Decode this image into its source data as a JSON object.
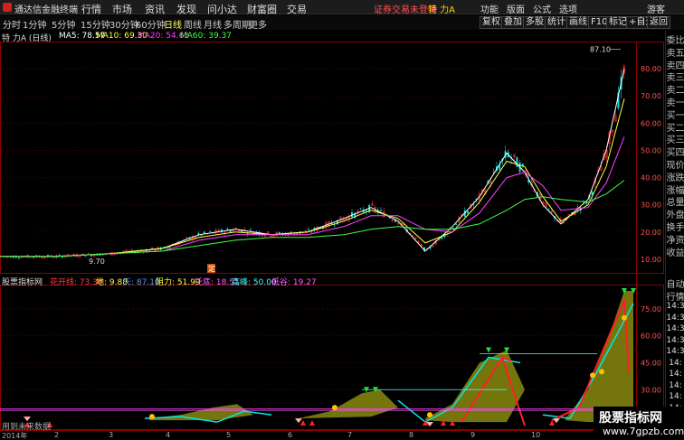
{
  "titlebar": {
    "app_name": "通达信金融终端",
    "menus": [
      "行情",
      "市场",
      "资讯",
      "发现",
      "问小达",
      "财富圈",
      "交易"
    ],
    "login_status": "证券交易未登录",
    "stock_name": "特 力A",
    "right_items": [
      "功能",
      "版面",
      "公式",
      "选项",
      "游客"
    ]
  },
  "toolbar": {
    "periods": [
      "分时",
      "1分钟",
      "5分钟",
      "15分钟",
      "30分钟",
      "60分钟",
      "日线",
      "周线",
      "月线",
      "多周期",
      "更多"
    ],
    "active_period": "日线",
    "buttons": [
      "复权",
      "叠加",
      "多股",
      "统计",
      "画线",
      "F10",
      "标记",
      "+自选",
      "返回"
    ]
  },
  "ma_legend": {
    "title": "特 力A (日线)",
    "ma5": "MA5: 78.57",
    "ma10": "MA10: 69.30",
    "ma20": "MA20: 54.63",
    "ma60": "MA60: 39.37"
  },
  "price_axis": {
    "labels": [
      "80.00",
      "70.00",
      "60.00",
      "50.00",
      "40.00",
      "30.00",
      "20.00",
      "10.00"
    ],
    "high_label": "87.10",
    "low_label": "9.70",
    "marker": "定"
  },
  "indicator_legend": {
    "name": "股票指标网",
    "items": [
      {
        "text": "花开线: 73.30",
        "color": "#ff4040"
      },
      {
        "text": "地: 9.88",
        "color": "#ffff40"
      },
      {
        "text": "天: 87.10",
        "color": "#40a0ff"
      },
      {
        "text": "阻力: 51.99",
        "color": "#ffff40"
      },
      {
        "text": "托底: 18.51",
        "color": "#ff60ff"
      },
      {
        "text": "高峰: 50.00",
        "color": "#40ffff"
      },
      {
        "text": "低谷: 19.27",
        "color": "#ff60ff"
      }
    ]
  },
  "indicator_axis": {
    "labels": [
      "75.00",
      "60.00",
      "45.00",
      "30.00",
      "15.00"
    ]
  },
  "side_panel": {
    "items": [
      "委比",
      "卖五",
      "卖四",
      "卖三",
      "卖二",
      "卖一",
      "买一",
      "买二",
      "买三",
      "买四",
      "现价",
      "涨跌",
      "涨幅",
      "总量",
      "外盘",
      "换手",
      "净资",
      "收益"
    ],
    "items2": [
      "自动",
      "行情"
    ],
    "times": [
      "14:3",
      "14:3",
      "14:3",
      "14:3",
      "14:3",
      "14:",
      "14:",
      "14:",
      "14:",
      "14:",
      "14:"
    ]
  },
  "bottom_note": "用到未来数据",
  "time_axis": {
    "labels": [
      "2014年",
      "2",
      "3",
      "4",
      "5",
      "6",
      "7",
      "8",
      "9",
      "10",
      "11"
    ]
  },
  "watermark": {
    "title": "股票指标网",
    "url": "www.7gpzb.com"
  },
  "colors": {
    "up": "#ff3030",
    "down": "#00e0e0",
    "ma5": "#ffffff",
    "ma10": "#ffff40",
    "ma20": "#ff40ff",
    "ma60": "#40ff40",
    "grid": "#8b0000"
  },
  "chart_data": {
    "type": "line",
    "series": [
      {
        "name": "MA5",
        "points": [
          [
            0,
            11
          ],
          [
            60,
            11
          ],
          [
            120,
            12
          ],
          [
            180,
            14
          ],
          [
            220,
            19
          ],
          [
            260,
            21
          ],
          [
            300,
            19
          ],
          [
            340,
            20
          ],
          [
            380,
            25
          ],
          [
            410,
            29
          ],
          [
            440,
            24
          ],
          [
            470,
            13
          ],
          [
            500,
            22
          ],
          [
            530,
            33
          ],
          [
            560,
            49
          ],
          [
            580,
            42
          ],
          [
            600,
            30
          ],
          [
            620,
            23
          ],
          [
            650,
            32
          ],
          [
            670,
            50
          ],
          [
            690,
            80
          ]
        ]
      },
      {
        "name": "MA10",
        "points": [
          [
            0,
            11
          ],
          [
            60,
            11
          ],
          [
            120,
            12
          ],
          [
            180,
            14
          ],
          [
            220,
            18
          ],
          [
            260,
            20
          ],
          [
            300,
            19
          ],
          [
            340,
            20
          ],
          [
            380,
            24
          ],
          [
            410,
            28
          ],
          [
            440,
            25
          ],
          [
            470,
            16
          ],
          [
            500,
            20
          ],
          [
            530,
            31
          ],
          [
            560,
            46
          ],
          [
            580,
            44
          ],
          [
            600,
            33
          ],
          [
            620,
            24
          ],
          [
            650,
            30
          ],
          [
            670,
            44
          ],
          [
            690,
            69
          ]
        ]
      },
      {
        "name": "MA20",
        "points": [
          [
            0,
            11
          ],
          [
            60,
            11
          ],
          [
            120,
            12
          ],
          [
            180,
            13
          ],
          [
            220,
            17
          ],
          [
            260,
            19
          ],
          [
            300,
            19
          ],
          [
            340,
            19
          ],
          [
            380,
            22
          ],
          [
            410,
            26
          ],
          [
            440,
            26
          ],
          [
            470,
            21
          ],
          [
            500,
            20
          ],
          [
            530,
            27
          ],
          [
            560,
            40
          ],
          [
            580,
            42
          ],
          [
            600,
            37
          ],
          [
            620,
            28
          ],
          [
            650,
            29
          ],
          [
            670,
            38
          ],
          [
            690,
            55
          ]
        ]
      },
      {
        "name": "MA60",
        "points": [
          [
            0,
            11
          ],
          [
            60,
            11
          ],
          [
            120,
            12
          ],
          [
            180,
            13
          ],
          [
            220,
            15
          ],
          [
            260,
            17
          ],
          [
            300,
            18
          ],
          [
            340,
            18
          ],
          [
            380,
            19
          ],
          [
            410,
            21
          ],
          [
            440,
            22
          ],
          [
            470,
            21
          ],
          [
            500,
            21
          ],
          [
            530,
            23
          ],
          [
            560,
            28
          ],
          [
            580,
            32
          ],
          [
            600,
            33
          ],
          [
            620,
            32
          ],
          [
            650,
            31
          ],
          [
            670,
            34
          ],
          [
            690,
            39
          ]
        ]
      }
    ],
    "ylim": [
      9.7,
      87.1
    ]
  }
}
